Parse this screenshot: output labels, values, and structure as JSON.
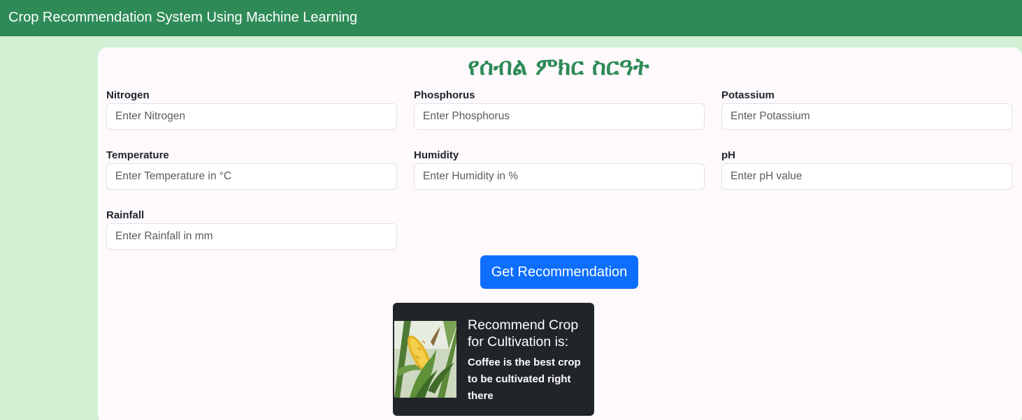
{
  "navbar": {
    "brand": "Crop Recommendation System Using Machine Learning"
  },
  "form": {
    "heading": "የሰብል ምክር ስርዓት",
    "fields": [
      {
        "label": "Nitrogen",
        "placeholder": "Enter Nitrogen"
      },
      {
        "label": "Phosphorus",
        "placeholder": "Enter Phosphorus"
      },
      {
        "label": "Potassium",
        "placeholder": "Enter Potassium"
      },
      {
        "label": "Temperature",
        "placeholder": "Enter Temperature in °C"
      },
      {
        "label": "Humidity",
        "placeholder": "Enter Humidity in %"
      },
      {
        "label": "pH",
        "placeholder": "Enter pH value"
      },
      {
        "label": "Rainfall",
        "placeholder": "Enter Rainfall in mm"
      }
    ],
    "submit_label": "Get Recommendation"
  },
  "result": {
    "title": "Recommend Crop for Cultivation is:",
    "text": "Coffee is the best crop to be cultivated right there",
    "image_icon": "corn-crop-image"
  },
  "colors": {
    "navbar": "#2e8b57",
    "page_background": "#d1f0d4",
    "heading": "#2e8b57",
    "button": "#0d6efd",
    "result_card": "#212529"
  }
}
